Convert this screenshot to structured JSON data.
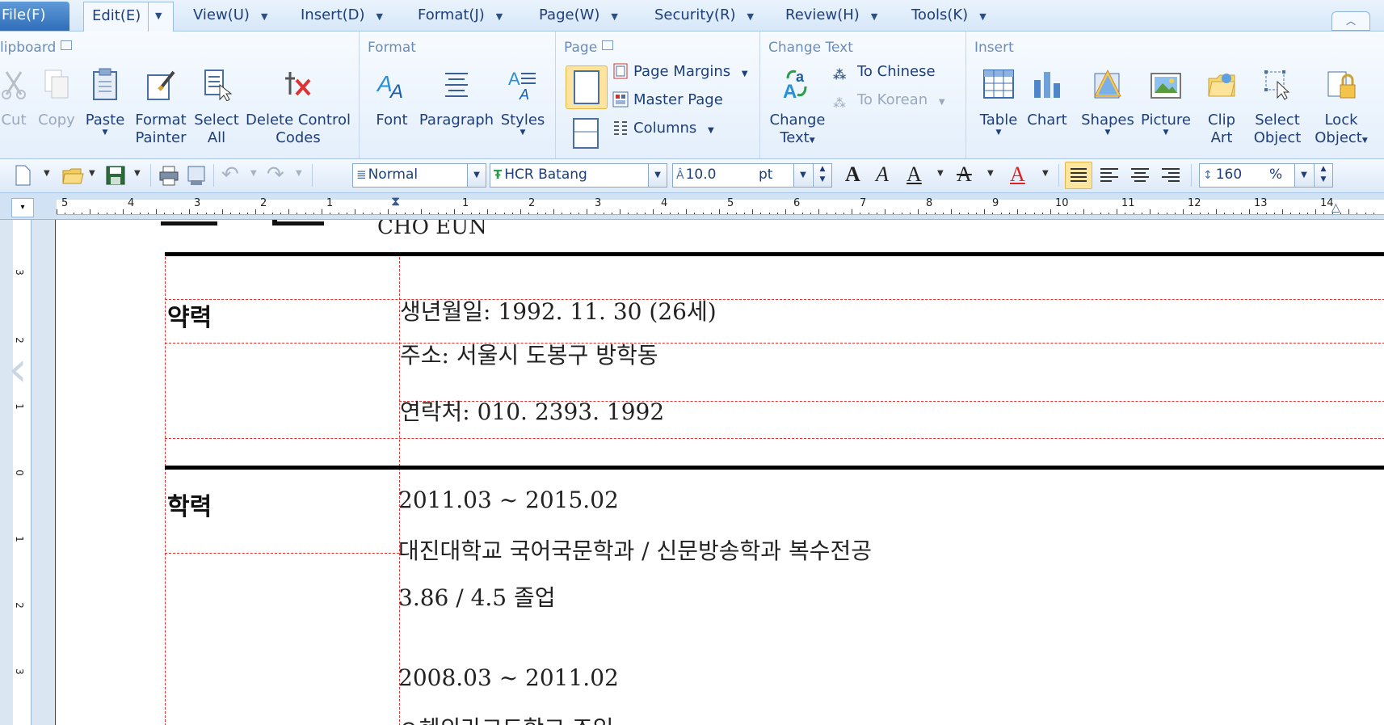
{
  "menubar": {
    "file": "File(F)",
    "edit": "Edit(E)",
    "items": [
      "View(U)",
      "Insert(D)",
      "Format(J)",
      "Page(W)",
      "Security(R)",
      "Review(H)",
      "Tools(K)"
    ]
  },
  "ribbon": {
    "clipboard": {
      "label": "lipboard",
      "cut": "Cut",
      "copy": "Copy",
      "paste": "Paste",
      "format_painter_1": "Format",
      "format_painter_2": "Painter",
      "select_all_1": "Select",
      "select_all_2": "All",
      "delete_codes_1": "Delete Control",
      "delete_codes_2": "Codes"
    },
    "format": {
      "label": "Format",
      "font": "Font",
      "paragraph": "Paragraph",
      "styles": "Styles"
    },
    "page": {
      "label": "Page",
      "margins": "Page Margins",
      "master": "Master Page",
      "columns": "Columns"
    },
    "change_text": {
      "label": "Change Text",
      "change_1": "Change",
      "change_2": "Text",
      "to_chinese": "To Chinese",
      "to_korean": "To Korean"
    },
    "insert": {
      "label": "Insert",
      "table": "Table",
      "chart": "Chart",
      "shapes": "Shapes",
      "picture": "Picture",
      "clip_1": "Clip",
      "clip_2": "Art",
      "select_obj_1": "Select",
      "select_obj_2": "Object",
      "lock_obj_1": "Lock",
      "lock_obj_2": "Object"
    }
  },
  "format_toolbar": {
    "style": "Normal",
    "font": "HCR Batang",
    "size": "10.0",
    "unit": "pt",
    "line_spacing": "160",
    "line_spacing_unit": "%"
  },
  "ruler": {
    "labels": [
      "5",
      "4",
      "3",
      "2",
      "1",
      "1",
      "2",
      "3",
      "4",
      "5",
      "6",
      "7",
      "8",
      "9",
      "10",
      "11",
      "12",
      "13",
      "14"
    ]
  },
  "vruler": {
    "labels": [
      "3",
      "2",
      "1",
      "0",
      "1",
      "2",
      "3"
    ]
  },
  "document": {
    "name_en": "CHO EUN",
    "section1": {
      "label": "약력",
      "lines": [
        "생년월일: 1992. 11. 30 (26세)",
        "주소: 서울시 도봉구 방학동",
        "연락처: 010. 2393. 1992"
      ]
    },
    "section2": {
      "label": "학력",
      "lines": [
        "2011.03 ~ 2015.02",
        "대진대학교 국어국문학과 / 신문방송학과 복수전공",
        "3.86 / 4.5 졸업",
        "2008.03 ~ 2011.02",
        "ㅇ혜의라고드학교 조입"
      ]
    }
  },
  "colors": {
    "accent": "#2f6db8",
    "table_guide": "#e03030"
  }
}
